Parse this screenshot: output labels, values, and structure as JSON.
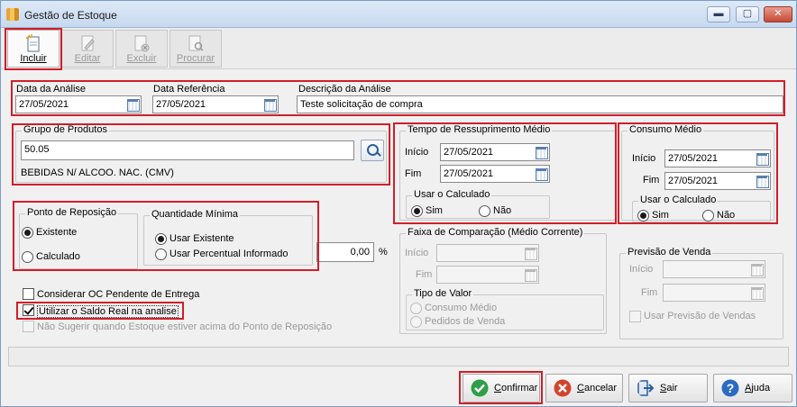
{
  "window": {
    "title": "Gestão de Estoque",
    "minimize": "▬",
    "maximize": "▢",
    "close": "✕"
  },
  "toolbar": {
    "incluir": "Incluir",
    "editar": "Editar",
    "excluir": "Excluir",
    "procurar": "Procurar"
  },
  "header": {
    "data_analise_label": "Data da Análise",
    "data_analise_value": "27/05/2021",
    "data_referencia_label": "Data Referência",
    "data_referencia_value": "27/05/2021",
    "descricao_label": "Descrição da Análise",
    "descricao_value": "Teste solicitação de compra"
  },
  "grupo": {
    "label": "Grupo de Produtos",
    "value": "50.05",
    "description": "BEBIDAS N/ ALCOO. NAC. (CMV)"
  },
  "ressuprimento": {
    "title": "Tempo de Ressuprimento Médio",
    "inicio_label": "Início",
    "inicio_value": "27/05/2021",
    "fim_label": "Fim",
    "fim_value": "27/05/2021",
    "usar_title": "Usar o Calculado",
    "sim": "Sim",
    "nao": "Não"
  },
  "consumo": {
    "title": "Consumo Médio",
    "inicio_label": "Início",
    "inicio_value": "27/05/2021",
    "fim_label": "Fim",
    "fim_value": "27/05/2021",
    "usar_title": "Usar o Calculado",
    "sim": "Sim",
    "nao": "Não"
  },
  "ponto_reposicao": {
    "title": "Ponto de Reposição",
    "existente": "Existente",
    "calculado": "Calculado"
  },
  "quantidade_minima": {
    "title": "Quantidade Mínima",
    "usar_existente": "Usar Existente",
    "usar_percentual": "Usar Percentual Informado",
    "percent_value": "0,00",
    "percent_sign": "%"
  },
  "faixa": {
    "title": "Faixa de Comparação (Médio Corrente)",
    "inicio_label": "Início",
    "fim_label": "Fim",
    "tipo_title": "Tipo de Valor",
    "consumo_medio": "Consumo Médio",
    "pedidos_venda": "Pedidos de Venda"
  },
  "previsao": {
    "title": "Previsão de Venda",
    "inicio_label": "Início",
    "fim_label": "Fim",
    "usar_previsao": "Usar Previsão de Vendas"
  },
  "options": {
    "considerar_oc": "Considerar OC Pendente de Entrega",
    "utilizar_saldo": "Utilizar o Saldo Real na analise",
    "nao_sugerir": "Não Sugerir quando Estoque estiver acima do Ponto de Reposição"
  },
  "footer": {
    "confirmar": "Confirmar",
    "cancelar": "Cancelar",
    "sair": "Sair",
    "ajuda": "Ajuda"
  },
  "colors": {
    "highlight": "#d01f2a",
    "confirm_green": "#2e9e4a",
    "cancel_red": "#d2452c",
    "help_blue": "#2c6bc2"
  }
}
